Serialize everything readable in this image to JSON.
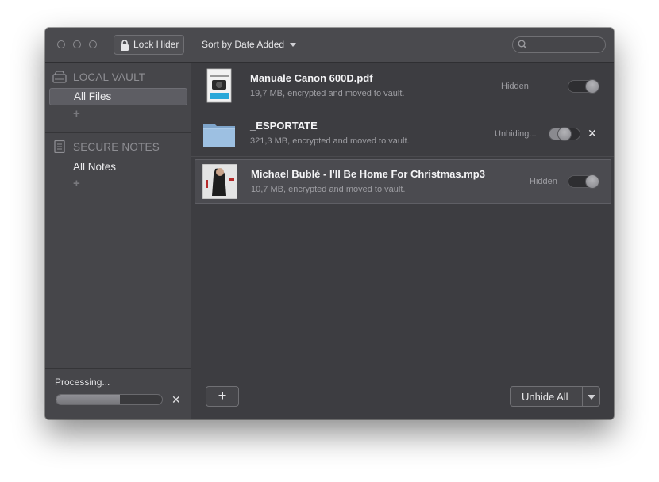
{
  "sidebar": {
    "lock_button": "Lock Hider",
    "local_vault": {
      "title": "LOCAL VAULT",
      "items": [
        {
          "label": "All Files",
          "selected": true
        }
      ],
      "add": "+"
    },
    "secure_notes": {
      "title": "SECURE NOTES",
      "items": [
        {
          "label": "All Notes",
          "selected": false
        }
      ],
      "add": "+"
    },
    "processing": {
      "label": "Processing...",
      "progress": 0.6,
      "cancel": "✕"
    }
  },
  "toolbar": {
    "sort_label": "Sort by Date Added",
    "search_placeholder": ""
  },
  "files": [
    {
      "name": "Manuale Canon 600D.pdf",
      "details": "19,7 MB, encrypted and moved to vault.",
      "status": "Hidden",
      "toggle": "on"
    },
    {
      "name": "_ESPORTATE",
      "details": "321,3 MB, encrypted and moved to vault.",
      "status": "Unhiding...",
      "toggle": "half",
      "cancel": "✕"
    },
    {
      "name": "Michael Bublé - I'll Be Home For Christmas.mp3",
      "details": "10,7 MB, encrypted and moved to vault.",
      "status": "Hidden",
      "toggle": "on",
      "selected": true
    }
  ],
  "footer": {
    "add_label": "+",
    "unhide_all_label": "Unhide All"
  },
  "colors": {
    "window_bg": "#3b3b3f",
    "sidebar_bg": "#46464a",
    "selected_row": "#4b4b50",
    "folder_blue": "#8fb3d6"
  }
}
